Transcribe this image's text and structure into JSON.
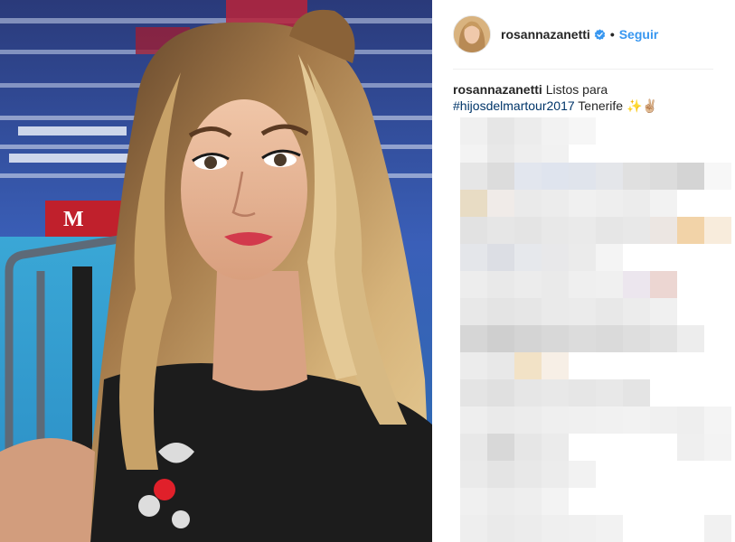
{
  "post": {
    "username": "rosannazanetti",
    "verified_icon": "verified-badge-icon",
    "separator": "•",
    "follow_label": "Seguir",
    "caption": {
      "username": "rosannazanetti",
      "text_before": "Listos para",
      "hashtag": "#hijosdelmartour2017",
      "text_after": "Tenerife",
      "emoji": "✨✌🏼"
    },
    "photo_icon": "selfie-photo",
    "comments_icon": "pixelated-comments-block"
  },
  "colors": {
    "follow": "#3897f0",
    "hashtag": "#003569",
    "verified": "#3897f0",
    "text": "#262626"
  }
}
